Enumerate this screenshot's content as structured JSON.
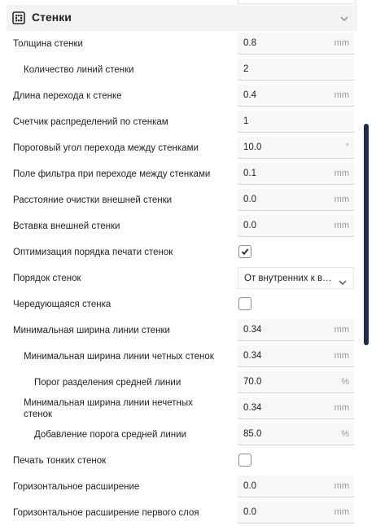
{
  "section": {
    "title": "Стенки",
    "icon": "wall-grid-icon",
    "toggle_icon": "chevron-down-icon"
  },
  "settings": [
    {
      "label": "Толщина стенки",
      "value": "0.8",
      "unit": "mm"
    },
    {
      "label": "Количество линий стенки",
      "value": "2",
      "unit": ""
    },
    {
      "label": "Длина перехода к стенке",
      "value": "0.4",
      "unit": "mm"
    },
    {
      "label": "Счетчик распределений по стенкам",
      "value": "1",
      "unit": ""
    },
    {
      "label": "Пороговый угол перехода между стенками",
      "value": "10.0",
      "unit": "°"
    },
    {
      "label": "Поле фильтра при переходе между стенками",
      "value": "0.1",
      "unit": "mm"
    },
    {
      "label": "Расстояние очистки внешней стенки",
      "value": "0.0",
      "unit": "mm"
    },
    {
      "label": "Вставка внешней стенки",
      "value": "0.0",
      "unit": "mm"
    },
    {
      "label": "Оптимизация порядка печати стенок",
      "checked": true
    },
    {
      "label": "Порядок стенок",
      "value": "От внутренних к внешним"
    },
    {
      "label": "Чередующаяся стенка",
      "checked": false
    },
    {
      "label": "Минимальная ширина линии стенки",
      "value": "0.34",
      "unit": "mm"
    },
    {
      "label": "Минимальная ширина линии четных стенок",
      "value": "0.34",
      "unit": "mm"
    },
    {
      "label": "Порог разделения средней линии",
      "value": "70.0",
      "unit": "%"
    },
    {
      "label": "Минимальная ширина линии нечетных стенок",
      "value": "0.34",
      "unit": "mm"
    },
    {
      "label": "Добавление порога средней линии",
      "value": "85.0",
      "unit": "%"
    },
    {
      "label": "Печать тонких стенок",
      "checked": false
    },
    {
      "label": "Горизонтальное расширение",
      "value": "0.0",
      "unit": "mm"
    },
    {
      "label": "Горизонтальное расширение первого слоя",
      "value": "0.0",
      "unit": "mm"
    }
  ],
  "colors": {
    "accent": "#1c2c4a",
    "header_bg": "#f3f3f3",
    "field_bg": "#f7f7f7",
    "unit_text": "#9a9a9a"
  }
}
